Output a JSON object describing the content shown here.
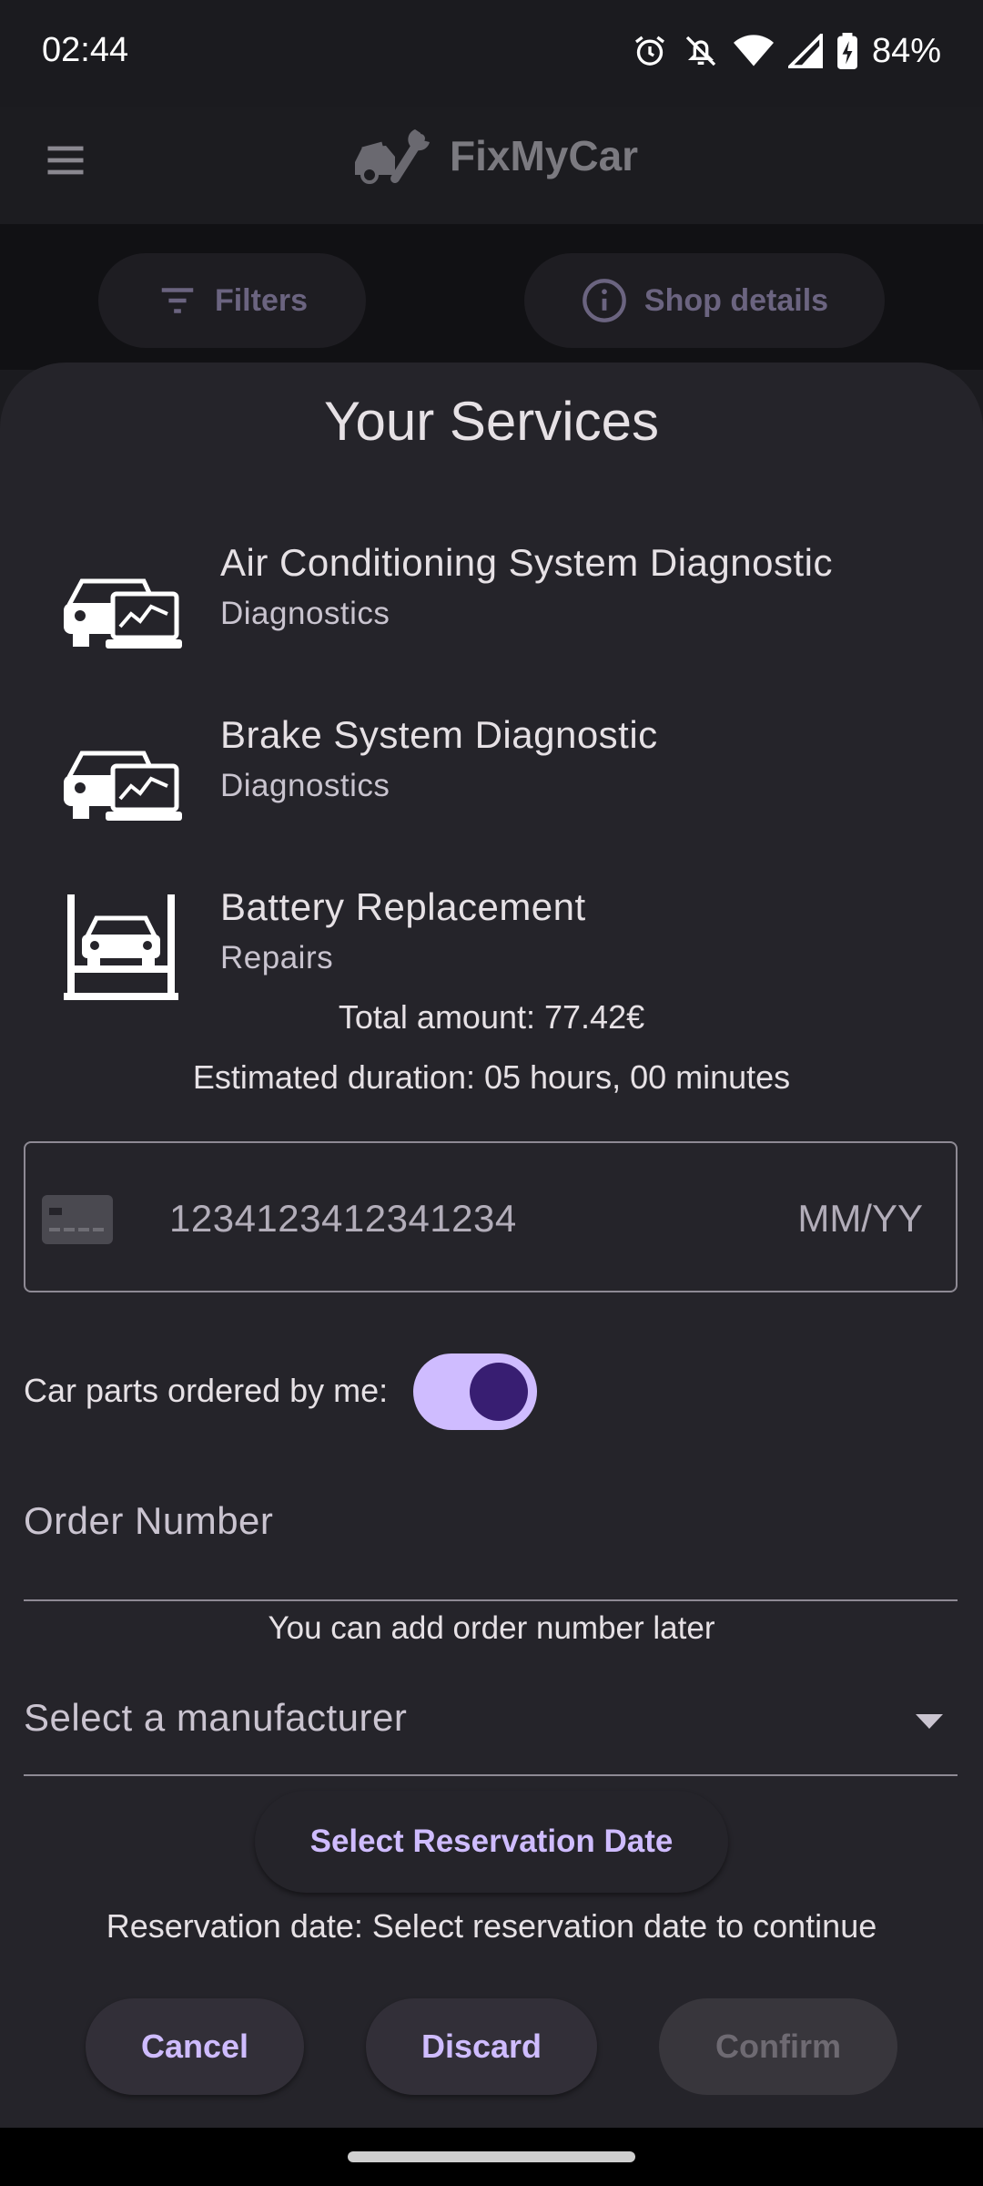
{
  "status_bar": {
    "time": "02:44",
    "battery": "84%"
  },
  "app_bar": {
    "title": "FixMyCar"
  },
  "chips": {
    "filters": "Filters",
    "shop_details": "Shop details"
  },
  "sheet": {
    "title": "Your Services",
    "services": [
      {
        "name": "Air Conditioning System Diagnostic",
        "category": "Diagnostics",
        "icon": "car-diagnostic-icon"
      },
      {
        "name": "Brake System Diagnostic",
        "category": "Diagnostics",
        "icon": "car-diagnostic-icon"
      },
      {
        "name": "Battery Replacement",
        "category": "Repairs",
        "icon": "car-lift-icon"
      }
    ],
    "total_amount": "Total amount: 77.42€",
    "estimated_duration": "Estimated duration: 05 hours, 00 minutes",
    "card": {
      "number_placeholder": "1234123412341234",
      "expiry_placeholder": "MM/YY"
    },
    "toggle": {
      "label": "Car parts ordered by me:",
      "checked": true
    },
    "order_number": {
      "label": "Order Number",
      "helper": "You can add order number later"
    },
    "manufacturer": {
      "label": "Select a manufacturer"
    },
    "reservation": {
      "button": "Select Reservation Date",
      "status": "Reservation date: Select reservation date to continue"
    },
    "actions": {
      "cancel": "Cancel",
      "discard": "Discard",
      "confirm": "Confirm"
    }
  },
  "colors": {
    "accent": "#cfbcff",
    "sheet_bg": "#25242a",
    "toggle_knob": "#381e72"
  }
}
